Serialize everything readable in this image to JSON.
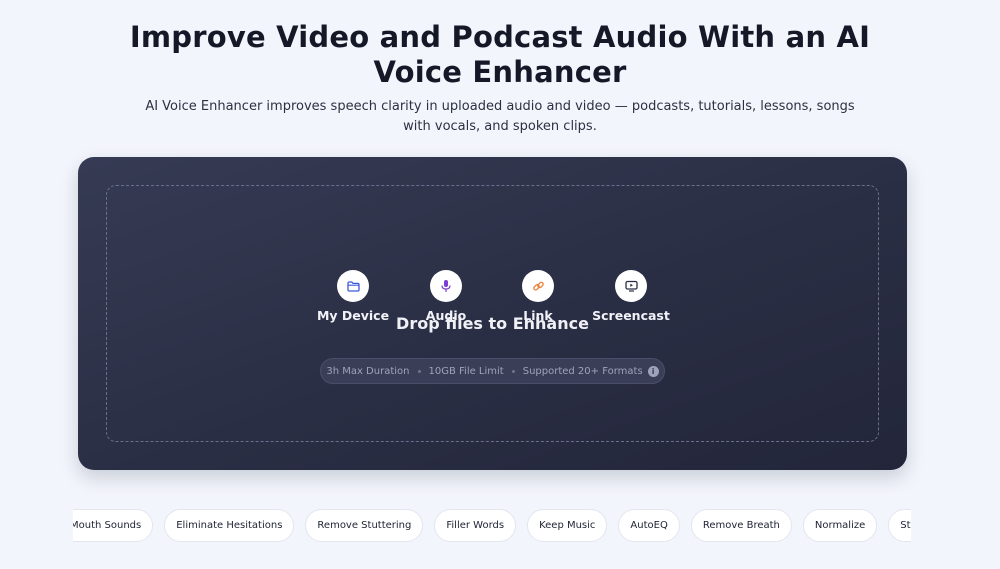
{
  "hero": {
    "title": "Improve Video and Podcast Audio With an AI Voice Enhancer",
    "subtitle": "AI Voice Enhancer improves speech clarity in uploaded audio and video — podcasts, tutorials, lessons, songs with vocals, and spoken clips."
  },
  "upload": {
    "sources": [
      {
        "label": "My Device",
        "icon": "folder-icon",
        "color": "#3b5bdb"
      },
      {
        "label": "Audio",
        "icon": "microphone-icon",
        "color": "#7b3fd1"
      },
      {
        "label": "Link",
        "icon": "link-icon",
        "color": "#e8833a"
      },
      {
        "label": "Screencast",
        "icon": "screen-icon",
        "color": "#2a2e44"
      }
    ],
    "drop_text": "Drop files to Enhance",
    "limits": [
      "3h Max Duration",
      "10GB File Limit",
      "Supported 20+ Formats"
    ],
    "info_icon": "info-icon"
  },
  "features": [
    "Mouth Sounds",
    "Eliminate Hesitations",
    "Remove Stuttering",
    "Filler Words",
    "Keep Music",
    "AutoEQ",
    "Remove Breath",
    "Normalize",
    "Studio Sound"
  ]
}
